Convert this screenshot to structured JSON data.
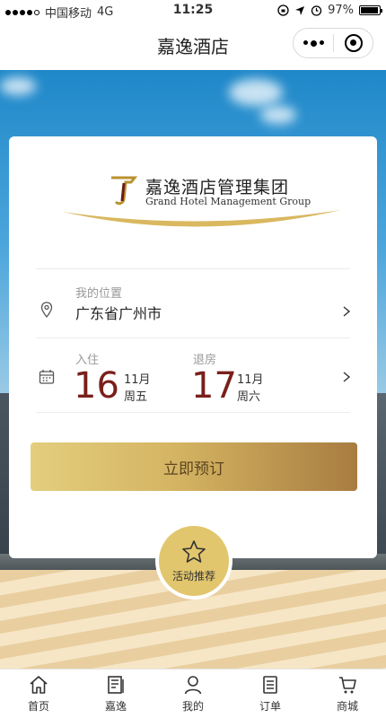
{
  "status_bar": {
    "carrier": "中国移动",
    "network": "4G",
    "time": "11:25",
    "battery": "97%"
  },
  "nav": {
    "title": "嘉逸酒店"
  },
  "logo": {
    "name_cn": "嘉逸酒店管理集团",
    "name_en": "Grand Hotel Management Group"
  },
  "location": {
    "label": "我的位置",
    "value": "广东省广州市"
  },
  "checkin": {
    "label": "入住",
    "day": "16",
    "month": "11月",
    "weekday": "周五"
  },
  "checkout": {
    "label": "退房",
    "day": "17",
    "month": "11月",
    "weekday": "周六"
  },
  "book_button": "立即预订",
  "promo_label": "活动推荐",
  "tabs": [
    {
      "label": "首页",
      "icon": "home-icon"
    },
    {
      "label": "嘉逸",
      "icon": "news-icon"
    },
    {
      "label": "我的",
      "icon": "user-icon"
    },
    {
      "label": "订单",
      "icon": "order-icon"
    },
    {
      "label": "商城",
      "icon": "cart-icon"
    }
  ],
  "colors": {
    "accent_gold": "#d4b462",
    "date_red": "#7a1f1a",
    "sky_blue": "#1f88c9"
  }
}
